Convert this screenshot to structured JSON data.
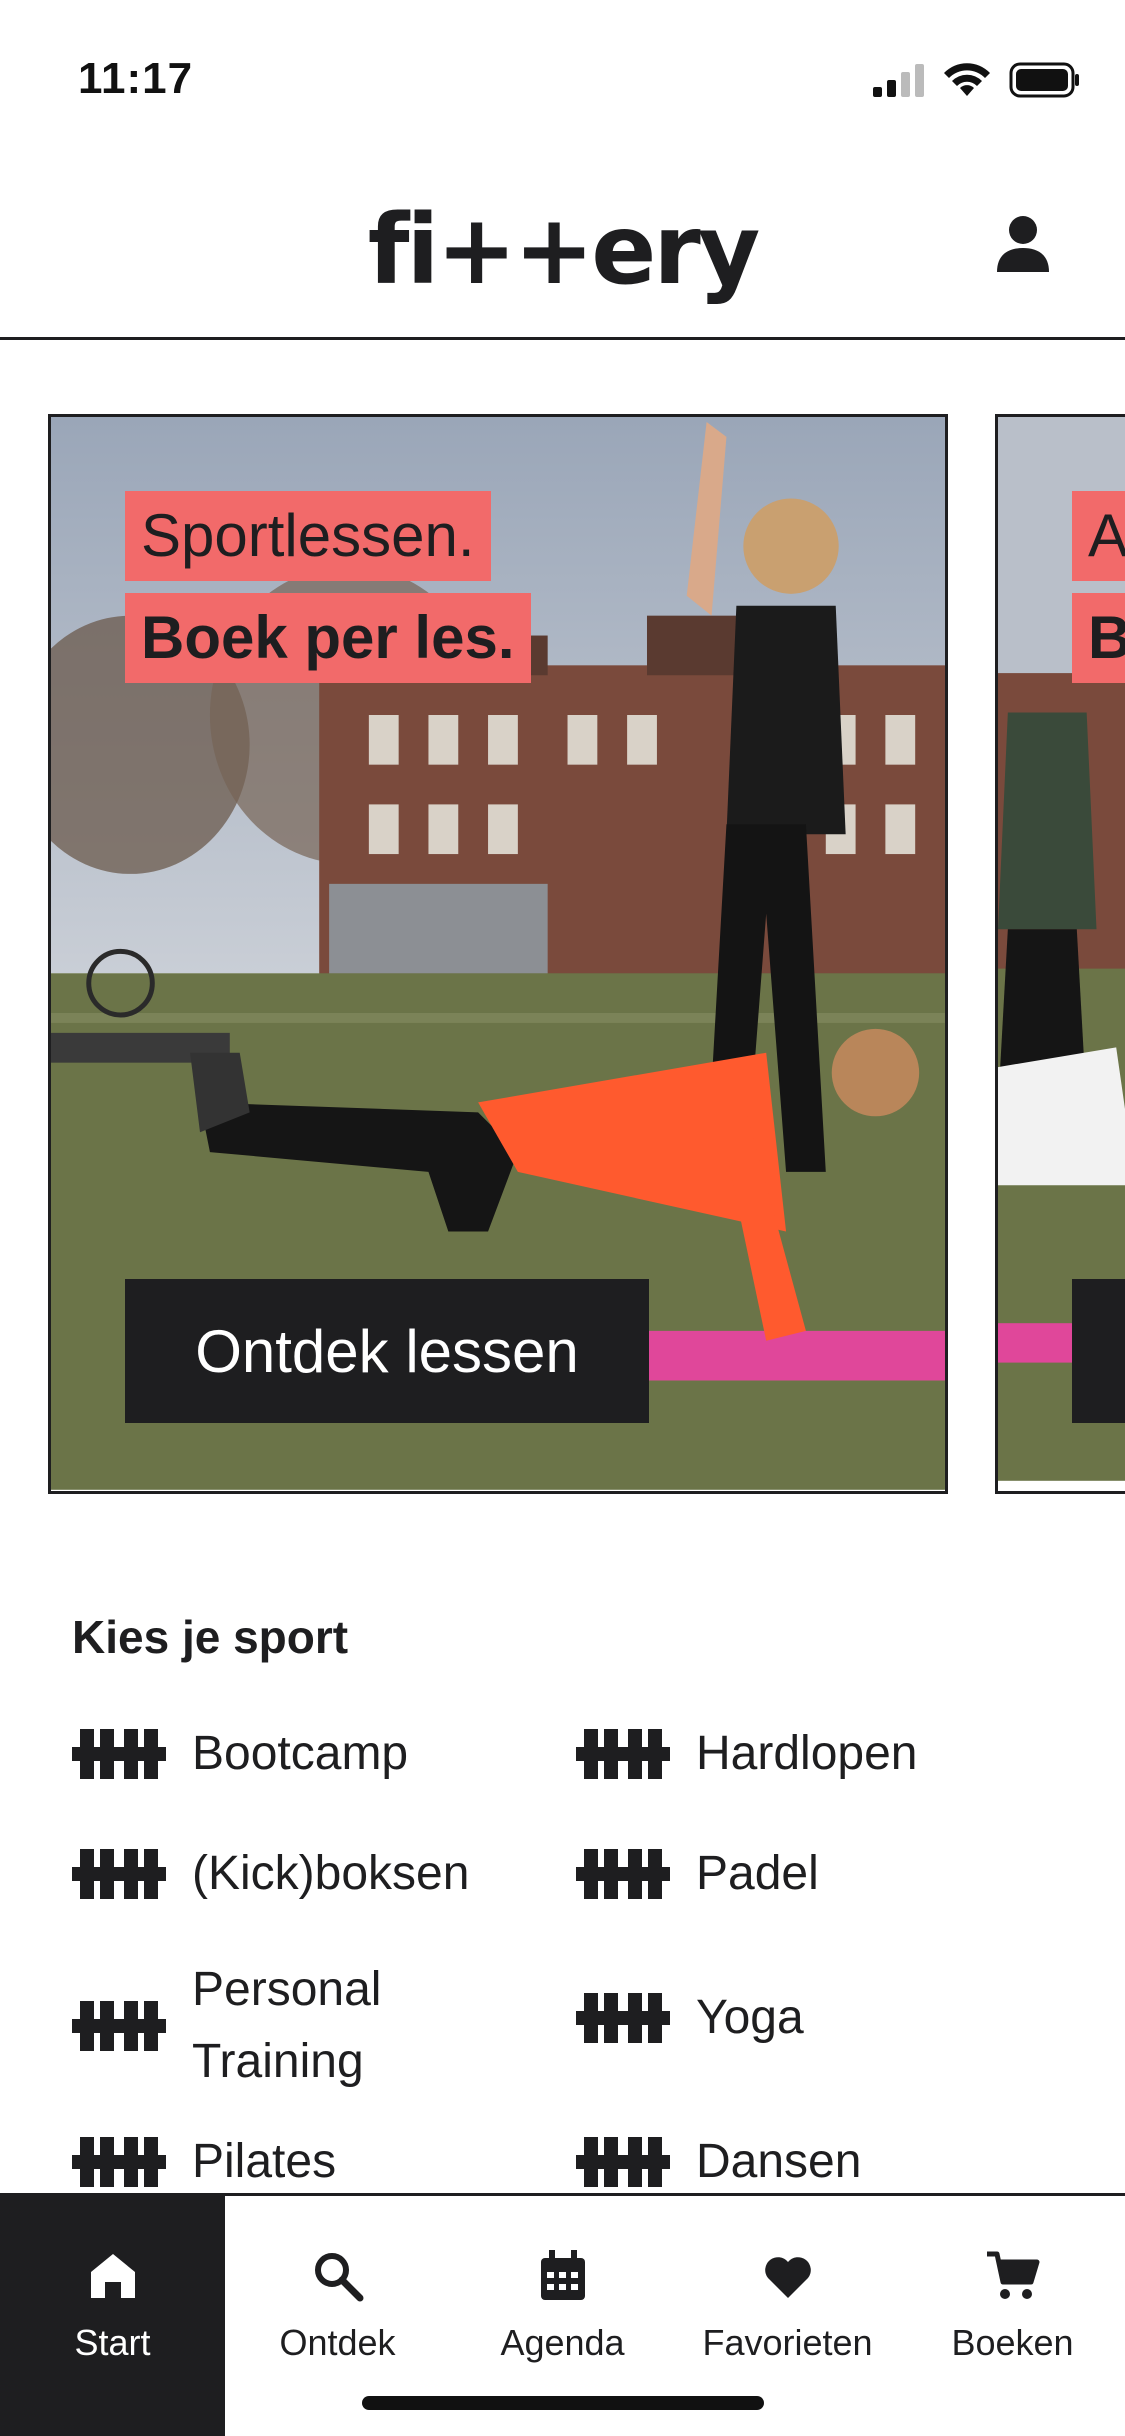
{
  "status_bar": {
    "time": "11:17"
  },
  "header": {
    "logo": "fi++ery",
    "account_icon": "person-icon"
  },
  "carousel": {
    "cards": [
      {
        "line1": "Sportlessen.",
        "line2": "Boek per les.",
        "button": "Ontdek lessen"
      },
      {
        "line1": "Ac",
        "line2": "B"
      }
    ]
  },
  "sports": {
    "title": "Kies je sport",
    "icon": "dumbbell-icon",
    "items": [
      "Bootcamp",
      "Hardlopen",
      "(Kick)boksen",
      "Padel",
      "Personal Training",
      "Yoga",
      "Pilates",
      "Dansen"
    ]
  },
  "tab_bar": {
    "active": "Start",
    "tabs": [
      {
        "label": "Start",
        "icon": "home-icon"
      },
      {
        "label": "Ontdek",
        "icon": "search-icon"
      },
      {
        "label": "Agenda",
        "icon": "calendar-icon"
      },
      {
        "label": "Favorieten",
        "icon": "heart-icon"
      },
      {
        "label": "Boeken",
        "icon": "cart-icon"
      }
    ]
  },
  "colors": {
    "dark": "#1e1e20",
    "accent": "#f26a6a",
    "mat": "#e0479a",
    "jacket": "#ff5a2e",
    "grass": "#6b7448"
  }
}
